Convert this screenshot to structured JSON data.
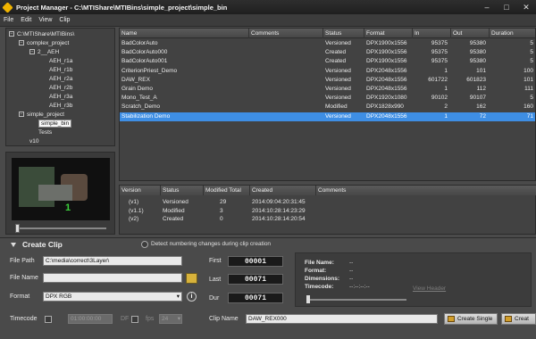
{
  "window": {
    "title": "Project Manager - C:\\MTIShare\\MTIBins\\simple_project\\simple_bin"
  },
  "menu": [
    "File",
    "Edit",
    "View",
    "Clip"
  ],
  "tree": {
    "root": "C:\\MTIShare\\MTIBins\\",
    "complex_project": "complex_project",
    "folder_2": "2__AEH",
    "aeh_items": [
      "AEH_r1a",
      "AEH_r1b",
      "AEH_r2a",
      "AEH_r2b",
      "AEH_r3a",
      "AEH_r3b"
    ],
    "simple_project": "simple_project",
    "simple_bin": "simple_bin",
    "tests": "Tests",
    "v10": "v10"
  },
  "preview": {
    "frame_number": "1"
  },
  "clips": {
    "headers": [
      "Name",
      "Comments",
      "Status",
      "Format",
      "In",
      "Out",
      "Duration"
    ],
    "rows": [
      [
        "BadColorAuto",
        "",
        "Versioned",
        "DPX1900x1556",
        "95375",
        "95380",
        "5"
      ],
      [
        "BadColorAuto000",
        "",
        "Created",
        "DPX1900x1556",
        "95375",
        "95380",
        "5"
      ],
      [
        "BadColorAuto001",
        "",
        "Created",
        "DPX1900x1556",
        "95375",
        "95380",
        "5"
      ],
      [
        "CriterionPriest_Demo",
        "",
        "Versioned",
        "DPX2048x1556",
        "1",
        "101",
        "100"
      ],
      [
        "DAW_REX",
        "",
        "Versioned",
        "DPX2048x1556",
        "601722",
        "601823",
        "101"
      ],
      [
        "Grain Demo",
        "",
        "Versioned",
        "DPX2048x1556",
        "1",
        "112",
        "111"
      ],
      [
        "Mono_Test_A",
        "",
        "Versioned",
        "DPX1920x1080",
        "90102",
        "90107",
        "5"
      ],
      [
        "Scratch_Demo",
        "",
        "Modified",
        "DPX1828x990",
        "2",
        "162",
        "160"
      ],
      [
        "Stabilization Demo",
        "",
        "Versioned",
        "DPX2048x1556",
        "1",
        "72",
        "71"
      ]
    ],
    "selected_index": 8
  },
  "versions": {
    "headers": [
      "Version",
      "Status",
      "Modified Total",
      "Created",
      "Comments"
    ],
    "rows": [
      [
        "(v1)",
        "Versioned",
        "29",
        "2014:09:04:20:31:45",
        ""
      ],
      [
        "(v1.1)",
        "Modified",
        "3",
        "2014:10:28:14:23:29",
        ""
      ],
      [
        "(v2)",
        "Created",
        "0",
        "2014:10:28:14:20:54",
        ""
      ]
    ]
  },
  "create_clip": {
    "title": "Create Clip",
    "detect_label": "Detect numbering changes during clip creation",
    "file_path_label": "File Path",
    "file_path_value": "C:\\media\\correct\\3Layer\\",
    "file_name_label": "File Name",
    "file_name_value": "",
    "format_label": "Format",
    "format_value": "DPX RGB",
    "timecode_label": "Timecode",
    "timecode_value": "01:00:00:00",
    "df_label": "DF",
    "fps_label": "fps",
    "fps_value": "24",
    "first_label": "First",
    "first_value": "00001",
    "last_label": "Last",
    "last_value": "00071",
    "dur_label": "Dur",
    "dur_value": "00071",
    "clip_name_label": "Clip Name",
    "clip_name_value": "DAW_REX000",
    "create_single_label": "Create Single",
    "create_label": "Creat"
  },
  "file_info": {
    "file_name_key": "File Name:",
    "file_name_val": "--",
    "format_key": "Format:",
    "format_val": "--",
    "dimensions_key": "Dimensions:",
    "dimensions_val": "--",
    "timecode_key": "Timecode:",
    "timecode_val": "--:--:--:--",
    "view_header": "View Header"
  }
}
